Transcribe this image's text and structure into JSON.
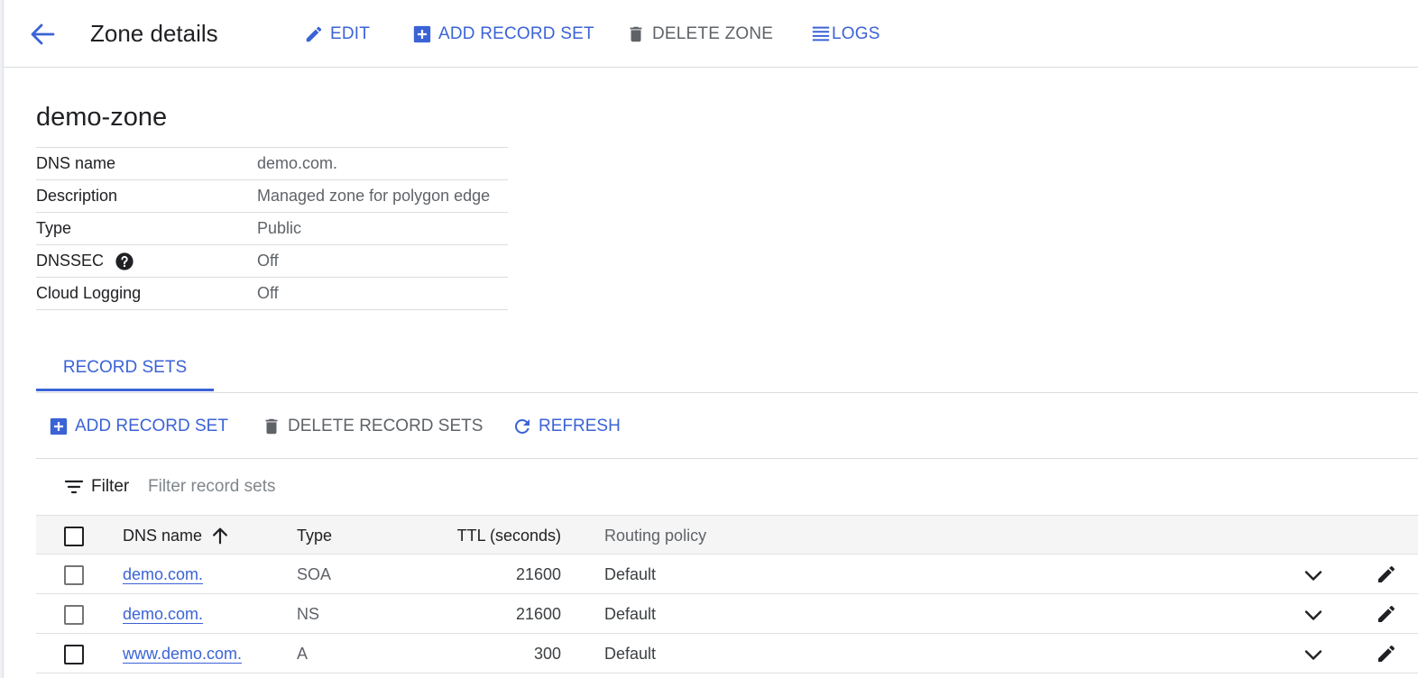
{
  "header": {
    "title": "Zone details",
    "actions": {
      "edit": "EDIT",
      "add_record_set": "ADD RECORD SET",
      "delete_zone": "DELETE ZONE",
      "logs": "LOGS"
    }
  },
  "zone": {
    "name": "demo-zone",
    "details": [
      {
        "key": "DNS name",
        "value": "demo.com."
      },
      {
        "key": "Description",
        "value": "Managed zone for polygon edge"
      },
      {
        "key": "Type",
        "value": "Public"
      },
      {
        "key": "DNSSEC",
        "value": "Off"
      },
      {
        "key": "Cloud Logging",
        "value": "Off"
      }
    ]
  },
  "tabs": [
    {
      "label": "RECORD SETS",
      "active": true
    }
  ],
  "record_toolbar": {
    "add": "ADD RECORD SET",
    "delete": "DELETE RECORD SETS",
    "refresh": "REFRESH"
  },
  "filter": {
    "label": "Filter",
    "placeholder": "Filter record sets"
  },
  "table": {
    "columns": {
      "dns_name": "DNS name",
      "type": "Type",
      "ttl": "TTL (seconds)",
      "routing_policy": "Routing policy"
    },
    "rows": [
      {
        "dns_name": "demo.com.",
        "type": "SOA",
        "ttl": "21600",
        "routing_policy": "Default"
      },
      {
        "dns_name": "demo.com.",
        "type": "NS",
        "ttl": "21600",
        "routing_policy": "Default"
      },
      {
        "dns_name": "www.demo.com.",
        "type": "A",
        "ttl": "300",
        "routing_policy": "Default"
      }
    ]
  },
  "colors": {
    "accent": "#3b63d6",
    "muted": "#5f6368",
    "divider": "#dadce0"
  },
  "icons": [
    "arrow-back-icon",
    "pencil-icon",
    "add-box-icon",
    "trash-icon",
    "list-icon",
    "help-icon",
    "refresh-icon",
    "filter-icon",
    "arrow-up-icon",
    "chevron-down-icon"
  ]
}
